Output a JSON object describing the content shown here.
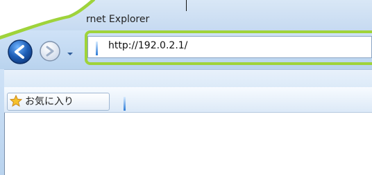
{
  "window": {
    "title_fragment": "rnet Explorer"
  },
  "address_bar": {
    "url": "http://192.0.2.1/"
  },
  "favorites": {
    "label": "お気に入り"
  },
  "icons": {
    "back": "back-arrow-icon",
    "forward": "forward-arrow-icon",
    "dropdown": "chevron-down-icon",
    "favorites": "star-icon"
  },
  "colors": {
    "highlight": "#9fd33a",
    "chrome_blue": "#c6daf1",
    "nav_blue": "#1f5fb7"
  }
}
